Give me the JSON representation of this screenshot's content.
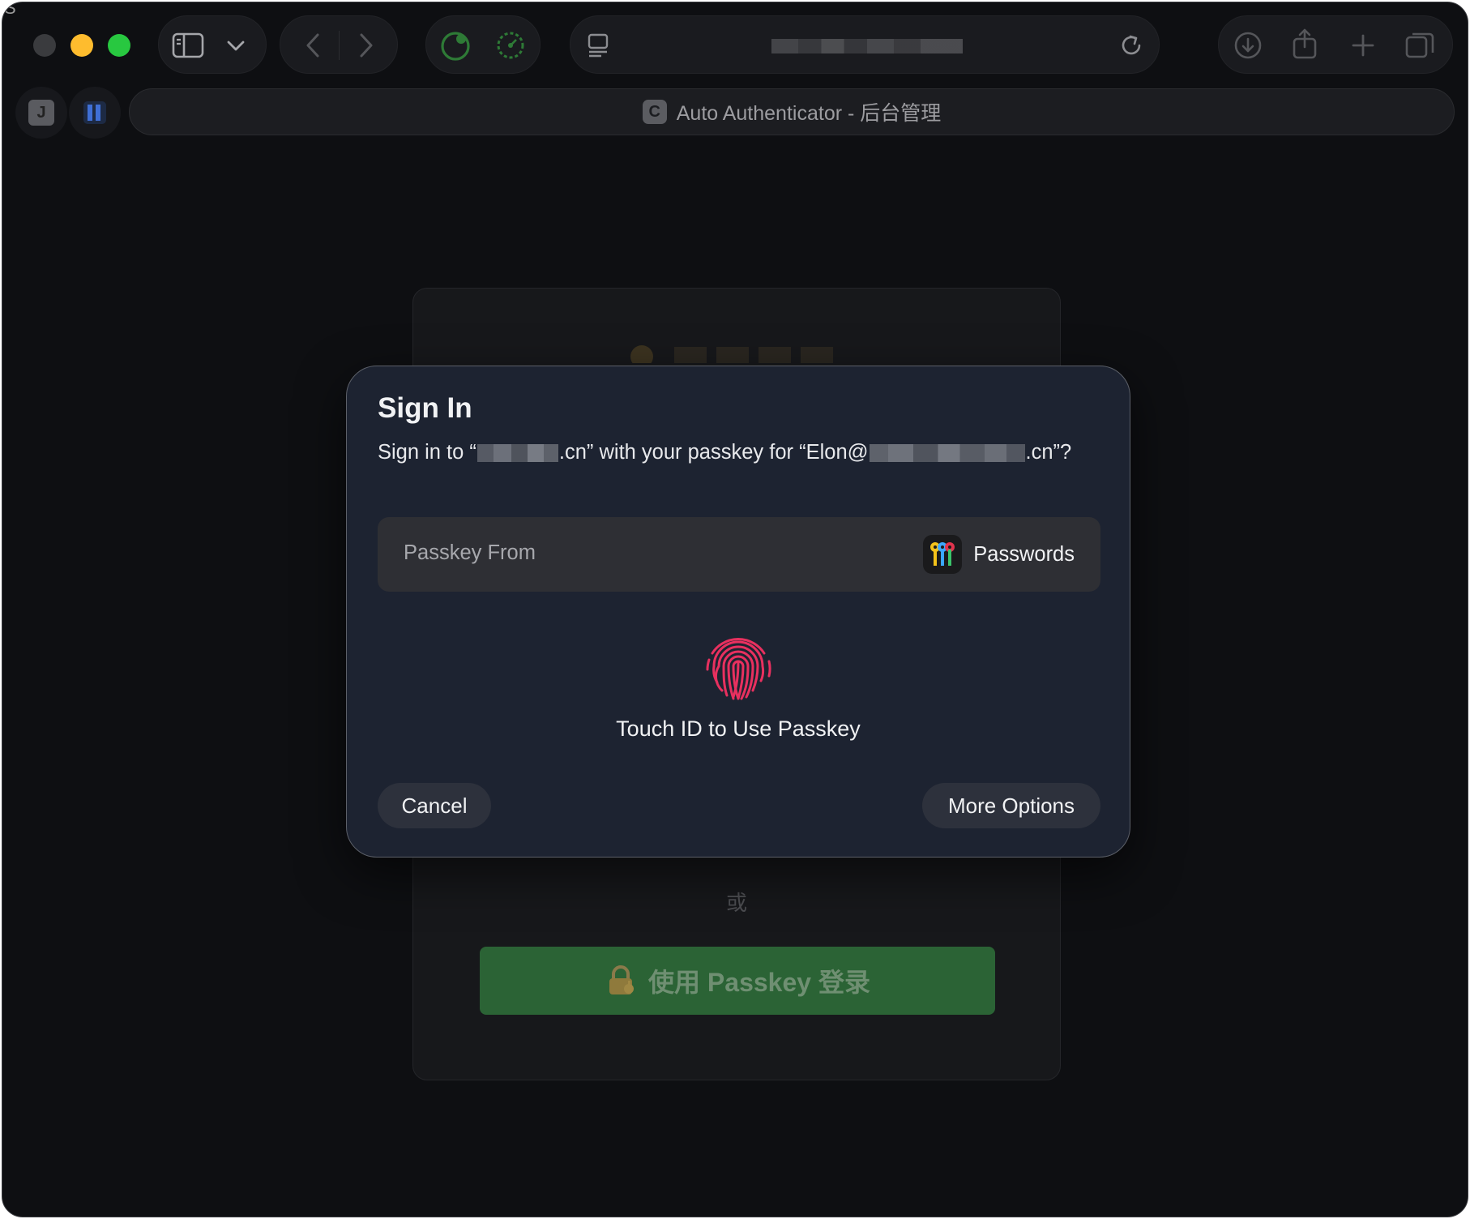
{
  "browser": {
    "tab_title": "Auto Authenticator - 后台管理",
    "tab_favicon_letter": "C",
    "side_tab_1_letter": "J",
    "corner_glyph": "S"
  },
  "page": {
    "divider_text": "或",
    "passkey_button_label": "使用 Passkey 登录",
    "passkey_button_icon": "lock-key-emoji"
  },
  "dialog": {
    "title": "Sign In",
    "subtitle_prefix": "Sign in to “",
    "subtitle_domain_suffix": ".cn” with your passkey for “Elon@",
    "subtitle_account_suffix": ".cn”?",
    "passkey_from_label": "Passkey From",
    "passkey_provider": "Passwords",
    "touch_id_label": "Touch ID to Use Passkey",
    "cancel_label": "Cancel",
    "more_options_label": "More Options"
  },
  "colors": {
    "traffic_close": "#3a3b3e",
    "traffic_minimize": "#febc2e",
    "traffic_zoom": "#28c840",
    "fingerprint": "#e8305f",
    "passkey_button": "#2b6335",
    "dialog_bg": "#1d2331"
  }
}
